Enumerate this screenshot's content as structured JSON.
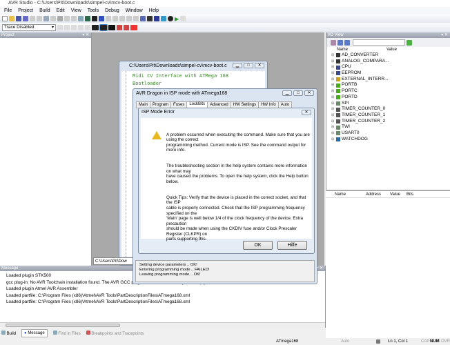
{
  "app": {
    "title": "AVR Studio - C:\\Users\\Pit\\Downloads\\simpel-cv\\mcv-boot.c"
  },
  "menu": [
    "File",
    "Project",
    "Build",
    "Edit",
    "View",
    "Tools",
    "Debug",
    "Window",
    "Help"
  ],
  "toolbar": {
    "trace_select": "Trace Disabled"
  },
  "project_panel": {
    "title": "Project"
  },
  "editor": {
    "title": "C:\\Users\\Pit\\Downloads\\simpel-cv\\mcv-boot.c",
    "lines": [
      "Midi CV Interface with ATMega 168",
      "Bootloader"
    ],
    "tab": "C:\\Users\\Pit\\Dow"
  },
  "dragon": {
    "title": "AVR Dragon in ISP mode with ATmega168",
    "tabs": [
      "Main",
      "Program",
      "Fuses",
      "LockBits",
      "Advanced",
      "HW Settings",
      "HW Info",
      "Auto"
    ],
    "active_tab": "LockBits",
    "log": [
      "Setting device parameters .. OK!",
      "Entering programming mode .. FAILED!",
      "Leaving programming mode .. OK!"
    ]
  },
  "error": {
    "title": "ISP Mode Error",
    "paragraphs": [
      "A problem occurred when executing the command. Make sure that you are using the correct\nprogramming method. Current mode is ISP. See the command output for more info.",
      "The troubleshooting section in the help system contains more information on what may\nhave caused the problems. To open the help system, click the Help button below.",
      "Quick Tips: Verify that the device is placed in the correct socket, and that the ISP\ncable is properly connected. Check that the ISP programming frequency specified on the\n'Main' page is well below 1/4 of the clock frequency of the device. Extra precaution\nshould be made when using the CKDIV fuse and/or Clock Prescaler Register (CLKPR) on\nparts supporting this."
    ],
    "ok": "OK",
    "help": "Hilfe"
  },
  "io_view": {
    "title": "I/O View",
    "columns": [
      "Name",
      "Value"
    ],
    "items": [
      {
        "name": "AD_CONVERTER",
        "color": "#333"
      },
      {
        "name": "ANALOG_COMPARA...",
        "color": "#333"
      },
      {
        "name": "CPU",
        "color": "#3a4a8a"
      },
      {
        "name": "EEPROM",
        "color": "#3a4a8a"
      },
      {
        "name": "EXTERNAL_INTERR...",
        "color": "#c8a020"
      },
      {
        "name": "PORTB",
        "color": "#4caa20"
      },
      {
        "name": "PORTC",
        "color": "#4caa20"
      },
      {
        "name": "PORTD",
        "color": "#4caa20"
      },
      {
        "name": "SPI",
        "color": "#6a8a6a"
      },
      {
        "name": "TIMER_COUNTER_0",
        "color": "#555"
      },
      {
        "name": "TIMER_COUNTER_1",
        "color": "#555"
      },
      {
        "name": "TIMER_COUNTER_2",
        "color": "#555"
      },
      {
        "name": "TWI",
        "color": "#6a8a6a"
      },
      {
        "name": "USART0",
        "color": "#6a8a6a"
      },
      {
        "name": "WATCHDOG",
        "color": "#2a6aa0"
      }
    ],
    "lower_columns": [
      "Name",
      "Address",
      "Value",
      "Bits"
    ]
  },
  "message_panel": {
    "title": "Message",
    "lines": [
      "Loaded plugin STK500",
      "gcc plug-in: No AVR Toolchain installation found. The AVR GCC plug-in can still be used if you set up your own build tools.",
      "Loaded plugin Atmel AVR Assembler",
      "Loaded partfile: C:\\Program Files (x86)\\Atmel\\AVR Tools\\PartDescriptionFiles\\ATmega168.xml",
      "Loaded partfile: C:\\Program Files (x86)\\Atmel\\AVR Tools\\PartDescriptionFiles\\ATmega168.xml"
    ],
    "tabs": [
      "Build",
      "Message",
      "Find in Files",
      "Breakpoints and Tracepoints"
    ]
  },
  "status": {
    "device": "ATmega168",
    "mode": "Auto",
    "position": "Ln 1, Col 1",
    "cap": "CAP",
    "num": "NUM",
    "ovr": "OVR"
  }
}
